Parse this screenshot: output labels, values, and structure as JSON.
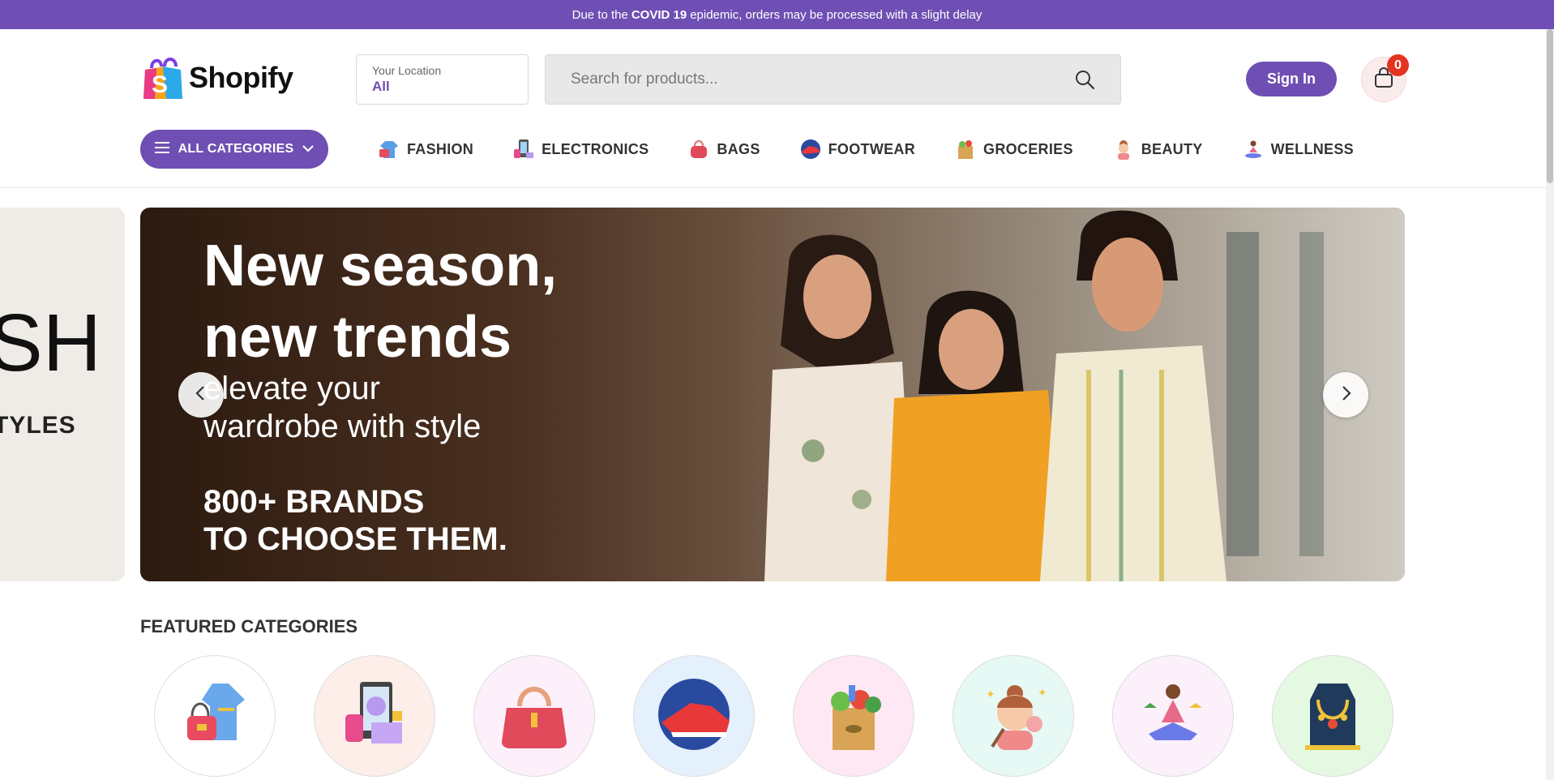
{
  "announcement": {
    "prefix": "Due to the",
    "highlight": "COVID 19",
    "suffix": "epidemic, orders may be processed with a slight delay"
  },
  "brand": {
    "name": "Shopify"
  },
  "location": {
    "label": "Your Location",
    "value": "All"
  },
  "search": {
    "placeholder": "Search for products..."
  },
  "auth": {
    "signin_label": "Sign In"
  },
  "cart": {
    "count": "0"
  },
  "nav": {
    "all_categories_label": "ALL CATEGORIES",
    "items": [
      {
        "label": "FASHION",
        "icon": "fashion-icon"
      },
      {
        "label": "ELECTRONICS",
        "icon": "electronics-icon"
      },
      {
        "label": "BAGS",
        "icon": "bags-icon"
      },
      {
        "label": "FOOTWEAR",
        "icon": "footwear-icon"
      },
      {
        "label": "GROCERIES",
        "icon": "groceries-icon"
      },
      {
        "label": "BEAUTY",
        "icon": "beauty-icon"
      },
      {
        "label": "WELLNESS",
        "icon": "wellness-icon"
      }
    ]
  },
  "slider": {
    "prev_slide": {
      "big": "SH",
      "small": "TYLES"
    },
    "headline_1": "New season,",
    "headline_2": "new trends",
    "sub_1": "elevate your",
    "sub_2": "wardrobe with style",
    "cta_1": "800+ BRANDS",
    "cta_2": "TO CHOOSE THEM."
  },
  "featured": {
    "title": "FEATURED CATEGORIES",
    "categories": [
      {
        "icon": "fashion-icon",
        "bg": "#ffffff"
      },
      {
        "icon": "electronics-icon",
        "bg": "#fdeeea"
      },
      {
        "icon": "bags-icon",
        "bg": "#fdf0fa"
      },
      {
        "icon": "footwear-icon",
        "bg": "#e4f1fd"
      },
      {
        "icon": "groceries-icon",
        "bg": "#fde8f3"
      },
      {
        "icon": "beauty-icon",
        "bg": "#e6f9f4"
      },
      {
        "icon": "wellness-icon",
        "bg": "#fcf0fb"
      },
      {
        "icon": "jewellery-icon",
        "bg": "#e4f8e2"
      }
    ]
  },
  "colors": {
    "accent": "#6f4fb3",
    "badge": "#e53322"
  }
}
